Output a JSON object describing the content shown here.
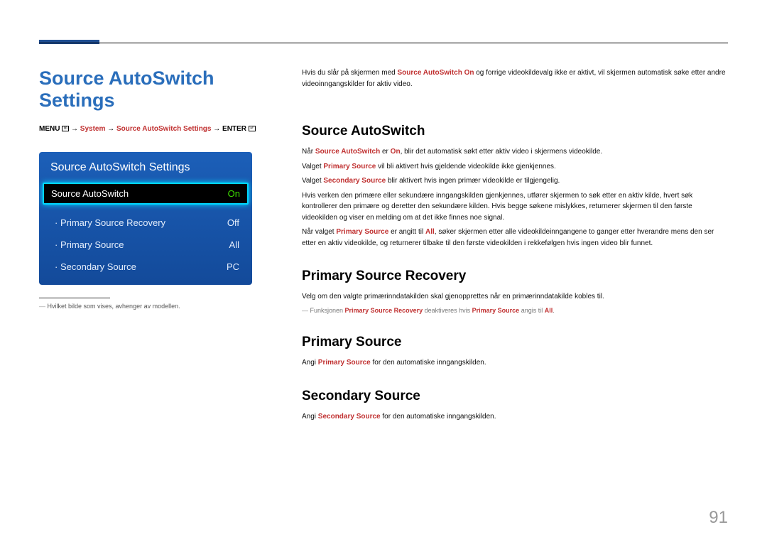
{
  "pageTitle": "Source AutoSwitch Settings",
  "breadcrumb": {
    "menu": "MENU",
    "arrow": " → ",
    "p1": "System",
    "p2": "Source AutoSwitch Settings",
    "enter": "ENTER"
  },
  "menuPanel": {
    "title": "Source AutoSwitch Settings",
    "selected": {
      "label": "Source AutoSwitch",
      "value": "On"
    },
    "items": [
      {
        "label": "Primary Source Recovery",
        "value": "Off"
      },
      {
        "label": "Primary Source",
        "value": "All"
      },
      {
        "label": "Secondary Source",
        "value": "PC"
      }
    ]
  },
  "footnote": "Hvilket bilde som vises, avhenger av modellen.",
  "intro": {
    "t1a": "Hvis du slår på skjermen med ",
    "t1b": "Source AutoSwitch On",
    "t1c": " og forrige videokildevalg ikke er aktivt, vil skjermen automatisk søke etter andre videoinngangskilder for aktiv video."
  },
  "sec1": {
    "h": "Source AutoSwitch",
    "p1a": "Når ",
    "p1b": "Source AutoSwitch",
    "p1c": " er ",
    "p1d": "On",
    "p1e": ", blir det automatisk søkt etter aktiv video i skjermens videokilde.",
    "p2a": "Valget ",
    "p2b": "Primary Source",
    "p2c": " vil bli aktivert hvis gjeldende videokilde ikke gjenkjennes.",
    "p3a": "Valget ",
    "p3b": "Secondary Source",
    "p3c": " blir aktivert hvis ingen primær videokilde er tilgjengelig.",
    "p4": "Hvis verken den primære eller sekundære inngangskilden gjenkjennes, utfører skjermen to søk etter en aktiv kilde, hvert søk kontrollerer den primære og deretter den sekundære kilden. Hvis begge søkene mislykkes, returnerer skjermen til den første videokilden og viser en melding om at det ikke finnes noe signal.",
    "p5a": "Når valget ",
    "p5b": "Primary Source",
    "p5c": " er angitt til ",
    "p5d": "All",
    "p5e": ", søker skjermen etter alle videokildeinngangene to ganger etter hverandre mens den ser etter en aktiv videokilde, og returnerer tilbake til den første videokilden i rekkefølgen hvis ingen video blir funnet."
  },
  "sec2": {
    "h": "Primary Source Recovery",
    "p1": "Velg om den valgte primærinndatakilden skal gjenopprettes når en primærinndatakilde kobles til.",
    "n1a": "Funksjonen ",
    "n1b": "Primary Source Recovery",
    "n1c": " deaktiveres hvis ",
    "n1d": "Primary Source",
    "n1e": " angis til ",
    "n1f": "All",
    "n1g": "."
  },
  "sec3": {
    "h": "Primary Source",
    "p1a": "Angi ",
    "p1b": "Primary Source",
    "p1c": " for den automatiske inngangskilden."
  },
  "sec4": {
    "h": "Secondary Source",
    "p1a": "Angi ",
    "p1b": "Secondary Source",
    "p1c": " for den automatiske inngangskilden."
  },
  "pageNumber": "91"
}
